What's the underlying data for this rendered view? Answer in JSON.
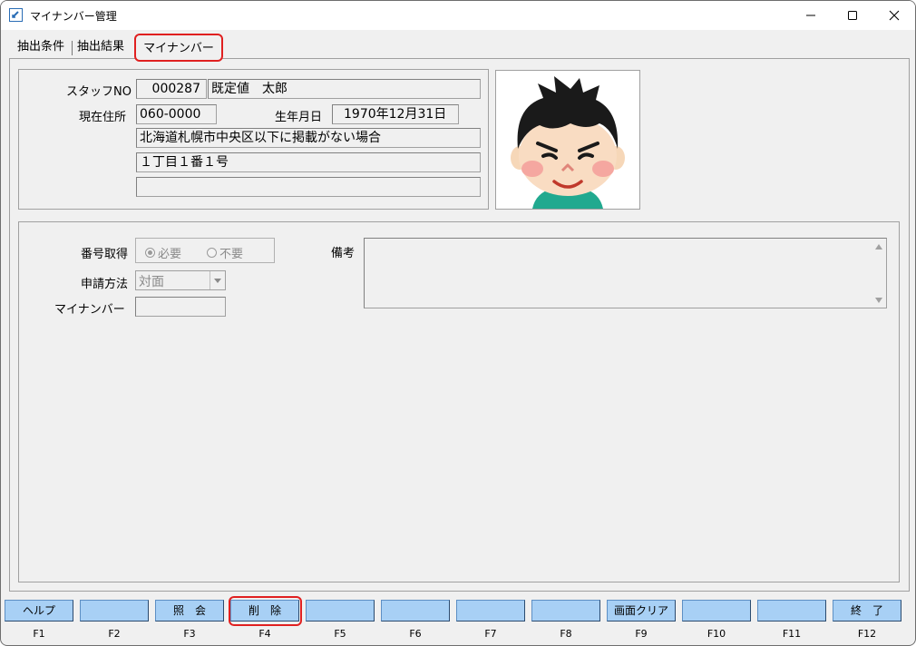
{
  "window": {
    "title": "マイナンバー管理"
  },
  "tabs": [
    {
      "label": "抽出条件"
    },
    {
      "label": "抽出結果"
    },
    {
      "label": "マイナンバー",
      "active": true
    }
  ],
  "staff": {
    "staff_no_label": "スタッフNO",
    "staff_no": "000287",
    "name": "既定値　太郎",
    "address_label": "現在住所",
    "postal_code": "060-0000",
    "birth_label": "生年月日",
    "birth_date": "1970年12月31日",
    "address1": "北海道札幌市中央区以下に掲載がない場合",
    "address2": "１丁目１番１号",
    "address3": ""
  },
  "mynumber": {
    "acquire_label": "番号取得",
    "acquire_options": [
      "必要",
      "不要"
    ],
    "acquire_selected": "必要",
    "method_label": "申請方法",
    "method_value": "対面",
    "number_label": "マイナンバー",
    "number_value": "",
    "remarks_label": "備考",
    "remarks_value": ""
  },
  "function_keys": [
    {
      "key": "F1",
      "label": "ヘルプ"
    },
    {
      "key": "F2",
      "label": ""
    },
    {
      "key": "F3",
      "label": "照　会"
    },
    {
      "key": "F4",
      "label": "削　除"
    },
    {
      "key": "F5",
      "label": ""
    },
    {
      "key": "F6",
      "label": ""
    },
    {
      "key": "F7",
      "label": ""
    },
    {
      "key": "F8",
      "label": ""
    },
    {
      "key": "F9",
      "label": "画面クリア"
    },
    {
      "key": "F10",
      "label": ""
    },
    {
      "key": "F11",
      "label": ""
    },
    {
      "key": "F12",
      "label": "終　了"
    }
  ],
  "colors": {
    "fkey_bg": "#a8d0f5",
    "highlight": "#e02020"
  },
  "icons": {
    "app": "app-icon",
    "minimize": "minimize-icon",
    "maximize": "maximize-icon",
    "close": "close-icon",
    "photo": "staff-photo"
  }
}
